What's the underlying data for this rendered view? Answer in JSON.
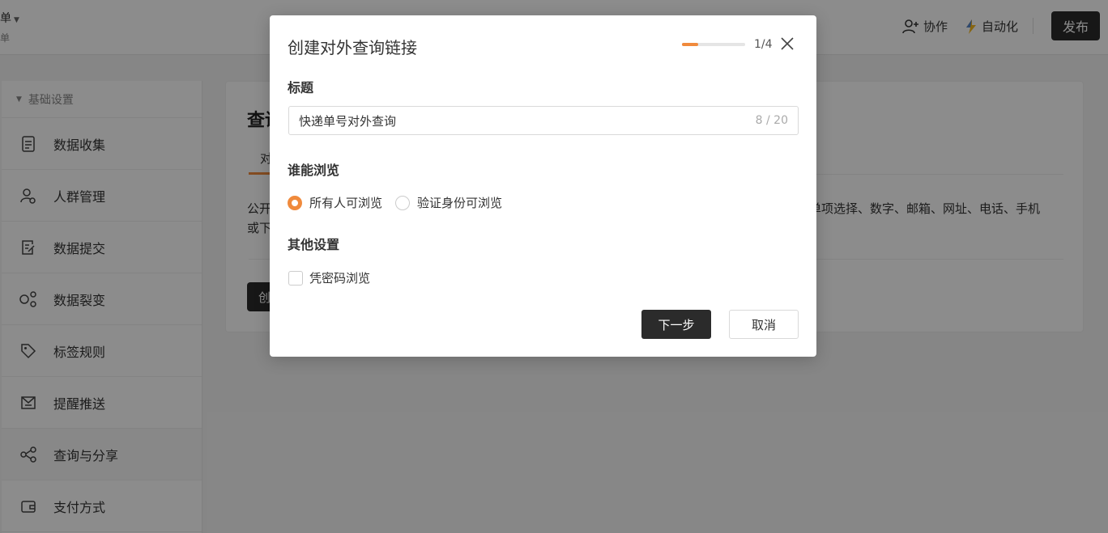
{
  "header": {
    "app_title": "表单",
    "app_subtitle": "表单",
    "collab_label": "协作",
    "automation_label": "自动化",
    "publish_label": "发布"
  },
  "sidebar": {
    "group_label": "基础设置",
    "items": [
      {
        "label": "数据收集",
        "icon": "document-icon"
      },
      {
        "label": "人群管理",
        "icon": "users-icon"
      },
      {
        "label": "数据提交",
        "icon": "submit-icon"
      },
      {
        "label": "数据裂变",
        "icon": "fission-icon"
      },
      {
        "label": "标签规则",
        "icon": "tag-icon"
      },
      {
        "label": "提醒推送",
        "icon": "mail-push-icon"
      },
      {
        "label": "查询与分享",
        "icon": "share-icon"
      },
      {
        "label": "支付方式",
        "icon": "wallet-icon"
      }
    ]
  },
  "main": {
    "title": "查询",
    "tab": "对",
    "desc_line1": "公开",
    "desc_line2": "或下",
    "desc_right": "单项选择、数字、邮箱、网址、电话、手机",
    "create_button": "创"
  },
  "modal": {
    "title": "创建对外查询链接",
    "progress": 0.25,
    "step": "1/4",
    "title_label": "标题",
    "title_value": "快递单号对外查询",
    "title_count": "8 / 20",
    "access_label": "谁能浏览",
    "access_options": [
      "所有人可浏览",
      "验证身份可浏览"
    ],
    "access_selected": 0,
    "other_label": "其他设置",
    "password_label": "凭密码浏览",
    "password_checked": false,
    "next_label": "下一步",
    "cancel_label": "取消",
    "accent_color": "#f08a3c"
  }
}
